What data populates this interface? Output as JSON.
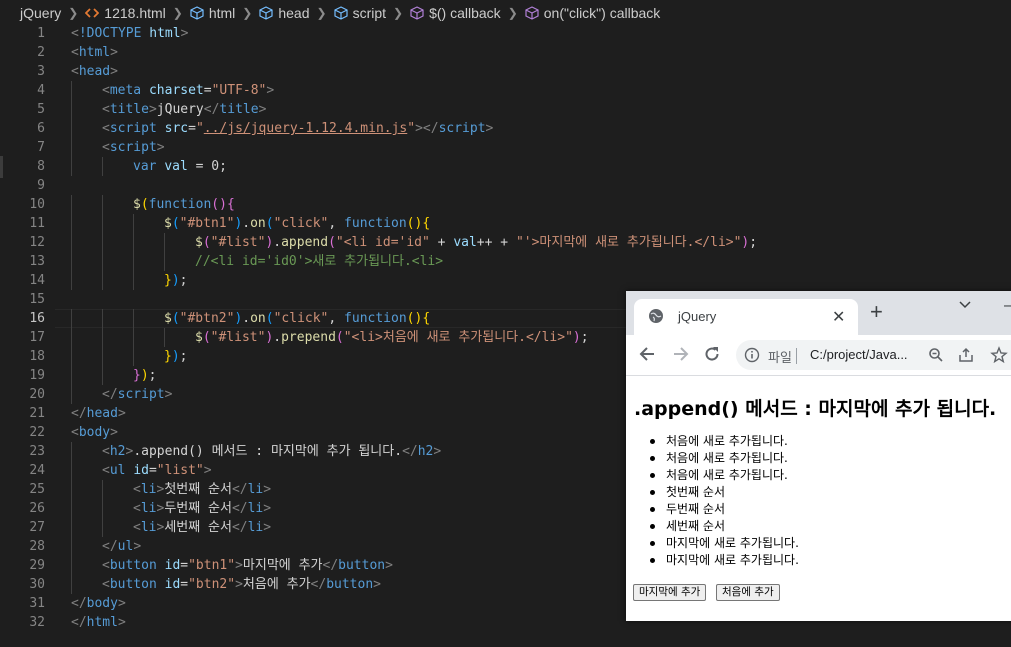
{
  "breadcrumb": [
    {
      "label": "jQuery",
      "icon": ""
    },
    {
      "label": "1218.html",
      "icon": "html-file-icon"
    },
    {
      "label": "html",
      "icon": "cube-icon"
    },
    {
      "label": "head",
      "icon": "cube-icon"
    },
    {
      "label": "script",
      "icon": "cube-icon"
    },
    {
      "label": "$() callback",
      "icon": "function-icon"
    },
    {
      "label": "on(\"click\") callback",
      "icon": "function-icon"
    }
  ],
  "editor": {
    "active_line": 16,
    "lines": [
      {
        "n": 1,
        "indent": 0,
        "tokens": [
          [
            "br",
            "<"
          ],
          [
            "tag",
            "!DOCTYPE "
          ],
          [
            "at",
            "html"
          ],
          [
            "br",
            ">"
          ]
        ]
      },
      {
        "n": 2,
        "indent": 0,
        "tokens": [
          [
            "br",
            "<"
          ],
          [
            "tag",
            "html"
          ],
          [
            "br",
            ">"
          ]
        ]
      },
      {
        "n": 3,
        "indent": 0,
        "tokens": [
          [
            "br",
            "<"
          ],
          [
            "tag",
            "head"
          ],
          [
            "br",
            ">"
          ]
        ]
      },
      {
        "n": 4,
        "indent": 1,
        "tokens": [
          [
            "br",
            "<"
          ],
          [
            "tag",
            "meta "
          ],
          [
            "at",
            "charset"
          ],
          [
            "tx",
            "="
          ],
          [
            "st",
            "\"UTF-8\""
          ],
          [
            "br",
            ">"
          ]
        ]
      },
      {
        "n": 5,
        "indent": 1,
        "tokens": [
          [
            "br",
            "<"
          ],
          [
            "tag",
            "title"
          ],
          [
            "br",
            ">"
          ],
          [
            "tx",
            "jQuery"
          ],
          [
            "br",
            "</"
          ],
          [
            "tag",
            "title"
          ],
          [
            "br",
            ">"
          ]
        ]
      },
      {
        "n": 6,
        "indent": 1,
        "tokens": [
          [
            "br",
            "<"
          ],
          [
            "tag",
            "script "
          ],
          [
            "at",
            "src"
          ],
          [
            "tx",
            "="
          ],
          [
            "st",
            "\""
          ],
          [
            "stu",
            "../js/jquery-1.12.4.min.js"
          ],
          [
            "st",
            "\""
          ],
          [
            "br",
            "></"
          ],
          [
            "tag",
            "script"
          ],
          [
            "br",
            ">"
          ]
        ]
      },
      {
        "n": 7,
        "indent": 1,
        "tokens": [
          [
            "br",
            "<"
          ],
          [
            "tag",
            "script"
          ],
          [
            "br",
            ">"
          ]
        ]
      },
      {
        "n": 8,
        "indent": 2,
        "tokens": [
          [
            "kw",
            "var "
          ],
          [
            "var",
            "val"
          ],
          [
            "tx",
            " = 0;"
          ]
        ]
      },
      {
        "n": 9,
        "indent": 0,
        "tokens": []
      },
      {
        "n": 10,
        "indent": 2,
        "tokens": [
          [
            "fn",
            "$"
          ],
          [
            "p1",
            "("
          ],
          [
            "kw",
            "function"
          ],
          [
            "p2",
            "()"
          ],
          [
            "p2",
            "{"
          ]
        ]
      },
      {
        "n": 11,
        "indent": 3,
        "tokens": [
          [
            "fn",
            "$"
          ],
          [
            "p3",
            "("
          ],
          [
            "st",
            "\"#btn1\""
          ],
          [
            "p3",
            ")"
          ],
          [
            "tx",
            "."
          ],
          [
            "fn",
            "on"
          ],
          [
            "p3",
            "("
          ],
          [
            "st",
            "\"click\""
          ],
          [
            "tx",
            ", "
          ],
          [
            "kw",
            "function"
          ],
          [
            "p1",
            "()"
          ],
          [
            "p1",
            "{"
          ]
        ]
      },
      {
        "n": 12,
        "indent": 4,
        "tokens": [
          [
            "fn",
            "$"
          ],
          [
            "p2",
            "("
          ],
          [
            "st",
            "\"#list\""
          ],
          [
            "p2",
            ")"
          ],
          [
            "tx",
            "."
          ],
          [
            "fn",
            "append"
          ],
          [
            "p2",
            "("
          ],
          [
            "st",
            "\"<li id='id\""
          ],
          [
            "tx",
            " + "
          ],
          [
            "var",
            "val"
          ],
          [
            "tx",
            "++ + "
          ],
          [
            "st",
            "\"'>마지막에 새로 추가됩니다.</li>\""
          ],
          [
            "p2",
            ")"
          ],
          [
            "tx",
            ";"
          ]
        ]
      },
      {
        "n": 13,
        "indent": 4,
        "tokens": [
          [
            "cm",
            "//<li id='id0'>새로 추가됩니다.<li>"
          ]
        ]
      },
      {
        "n": 14,
        "indent": 3,
        "tokens": [
          [
            "p1",
            "}"
          ],
          [
            "p3",
            ")"
          ],
          [
            "tx",
            ";"
          ]
        ]
      },
      {
        "n": 15,
        "indent": 0,
        "tokens": []
      },
      {
        "n": 16,
        "indent": 3,
        "tokens": [
          [
            "fn",
            "$"
          ],
          [
            "p3",
            "("
          ],
          [
            "st",
            "\"#btn2\""
          ],
          [
            "p3",
            ")"
          ],
          [
            "tx",
            "."
          ],
          [
            "fn",
            "on"
          ],
          [
            "p3",
            "("
          ],
          [
            "st",
            "\"click\""
          ],
          [
            "tx",
            ", "
          ],
          [
            "kw",
            "function"
          ],
          [
            "p1",
            "()"
          ],
          [
            "p1",
            "{"
          ]
        ]
      },
      {
        "n": 17,
        "indent": 4,
        "tokens": [
          [
            "fn",
            "$"
          ],
          [
            "p2",
            "("
          ],
          [
            "st",
            "\"#list\""
          ],
          [
            "p2",
            ")"
          ],
          [
            "tx",
            "."
          ],
          [
            "fn",
            "prepend"
          ],
          [
            "p2",
            "("
          ],
          [
            "st",
            "\"<li>처음에 새로 추가됩니다.</li>\""
          ],
          [
            "p2",
            ")"
          ],
          [
            "tx",
            ";"
          ]
        ]
      },
      {
        "n": 18,
        "indent": 3,
        "tokens": [
          [
            "p1",
            "}"
          ],
          [
            "p3",
            ")"
          ],
          [
            "tx",
            ";"
          ]
        ]
      },
      {
        "n": 19,
        "indent": 2,
        "tokens": [
          [
            "p2",
            "}"
          ],
          [
            "p1",
            ")"
          ],
          [
            "tx",
            ";"
          ]
        ]
      },
      {
        "n": 20,
        "indent": 1,
        "tokens": [
          [
            "br",
            "</"
          ],
          [
            "tag",
            "script"
          ],
          [
            "br",
            ">"
          ]
        ]
      },
      {
        "n": 21,
        "indent": 0,
        "tokens": [
          [
            "br",
            "</"
          ],
          [
            "tag",
            "head"
          ],
          [
            "br",
            ">"
          ]
        ]
      },
      {
        "n": 22,
        "indent": 0,
        "tokens": [
          [
            "br",
            "<"
          ],
          [
            "tag",
            "body"
          ],
          [
            "br",
            ">"
          ]
        ]
      },
      {
        "n": 23,
        "indent": 1,
        "tokens": [
          [
            "br",
            "<"
          ],
          [
            "tag",
            "h2"
          ],
          [
            "br",
            ">"
          ],
          [
            "tx",
            ".append() 메서드 : 마지막에 추가 됩니다."
          ],
          [
            "br",
            "</"
          ],
          [
            "tag",
            "h2"
          ],
          [
            "br",
            ">"
          ]
        ]
      },
      {
        "n": 24,
        "indent": 1,
        "tokens": [
          [
            "br",
            "<"
          ],
          [
            "tag",
            "ul "
          ],
          [
            "at",
            "id"
          ],
          [
            "tx",
            "="
          ],
          [
            "st",
            "\"list\""
          ],
          [
            "br",
            ">"
          ]
        ]
      },
      {
        "n": 25,
        "indent": 2,
        "tokens": [
          [
            "br",
            "<"
          ],
          [
            "tag",
            "li"
          ],
          [
            "br",
            ">"
          ],
          [
            "tx",
            "첫번째 순서"
          ],
          [
            "br",
            "</"
          ],
          [
            "tag",
            "li"
          ],
          [
            "br",
            ">"
          ]
        ]
      },
      {
        "n": 26,
        "indent": 2,
        "tokens": [
          [
            "br",
            "<"
          ],
          [
            "tag",
            "li"
          ],
          [
            "br",
            ">"
          ],
          [
            "tx",
            "두번째 순서"
          ],
          [
            "br",
            "</"
          ],
          [
            "tag",
            "li"
          ],
          [
            "br",
            ">"
          ]
        ]
      },
      {
        "n": 27,
        "indent": 2,
        "tokens": [
          [
            "br",
            "<"
          ],
          [
            "tag",
            "li"
          ],
          [
            "br",
            ">"
          ],
          [
            "tx",
            "세번째 순서"
          ],
          [
            "br",
            "</"
          ],
          [
            "tag",
            "li"
          ],
          [
            "br",
            ">"
          ]
        ]
      },
      {
        "n": 28,
        "indent": 1,
        "tokens": [
          [
            "br",
            "</"
          ],
          [
            "tag",
            "ul"
          ],
          [
            "br",
            ">"
          ]
        ]
      },
      {
        "n": 29,
        "indent": 1,
        "tokens": [
          [
            "br",
            "<"
          ],
          [
            "tag",
            "button "
          ],
          [
            "at",
            "id"
          ],
          [
            "tx",
            "="
          ],
          [
            "st",
            "\"btn1\""
          ],
          [
            "br",
            ">"
          ],
          [
            "tx",
            "마지막에 추가"
          ],
          [
            "br",
            "</"
          ],
          [
            "tag",
            "button"
          ],
          [
            "br",
            ">"
          ]
        ]
      },
      {
        "n": 30,
        "indent": 1,
        "tokens": [
          [
            "br",
            "<"
          ],
          [
            "tag",
            "button "
          ],
          [
            "at",
            "id"
          ],
          [
            "tx",
            "="
          ],
          [
            "st",
            "\"btn2\""
          ],
          [
            "br",
            ">"
          ],
          [
            "tx",
            "처음에 추가"
          ],
          [
            "br",
            "</"
          ],
          [
            "tag",
            "button"
          ],
          [
            "br",
            ">"
          ]
        ]
      },
      {
        "n": 31,
        "indent": 0,
        "tokens": [
          [
            "br",
            "</"
          ],
          [
            "tag",
            "body"
          ],
          [
            "br",
            ">"
          ]
        ]
      },
      {
        "n": 32,
        "indent": 0,
        "tokens": [
          [
            "br",
            "</"
          ],
          [
            "tag",
            "html"
          ],
          [
            "br",
            ">"
          ]
        ]
      }
    ]
  },
  "browser": {
    "tab_title": "jQuery",
    "new_tab": "+",
    "minimize": "–",
    "scheme_label": "파일",
    "url": "C:/project/Java...",
    "page": {
      "heading": ".append() 메서드 : 마지막에 추가 됩니다.",
      "list": [
        "처음에 새로 추가됩니다.",
        "처음에 새로 추가됩니다.",
        "처음에 새로 추가됩니다.",
        "첫번째 순서",
        "두번째 순서",
        "세번째 순서",
        "마지막에 새로 추가됩니다.",
        "마지막에 새로 추가됩니다."
      ],
      "btn1": "마지막에 추가",
      "btn2": "처음에 추가"
    }
  },
  "colors": {
    "editor_bg": "#1e1e1e",
    "tag": "#569cd6",
    "string": "#ce9178",
    "attribute": "#9cdcfe",
    "comment": "#6a9955"
  }
}
